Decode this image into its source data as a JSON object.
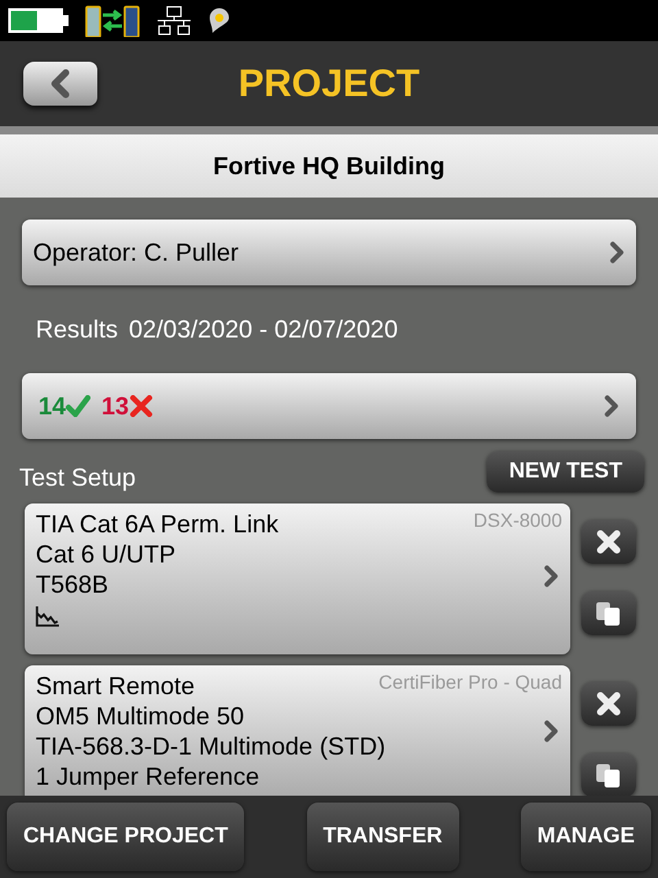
{
  "header": {
    "title": "PROJECT"
  },
  "project_name": "Fortive HQ Building",
  "operator": "Operator: C. Puller",
  "results": {
    "label": "Results",
    "dates": "02/03/2020 - 02/07/2020",
    "pass_count": "14",
    "fail_count": "13"
  },
  "test_setup": {
    "label": "Test Setup",
    "new_test_button": "NEW TEST",
    "setups": [
      {
        "kind": "copper",
        "device": "DSX-8000",
        "lines": [
          "TIA Cat 6A Perm. Link",
          "Cat 6 U/UTP",
          "T568B"
        ]
      },
      {
        "kind": "fiber",
        "device": "CertiFiber Pro - Quad",
        "lines": [
          "Smart Remote",
          "OM5 Multimode 50",
          "TIA-568.3-D-1 Multimode (STD)",
          "1 Jumper Reference"
        ]
      }
    ]
  },
  "footer_buttons": [
    "CHANGE PROJECT",
    "TRANSFER",
    "MANAGE"
  ]
}
